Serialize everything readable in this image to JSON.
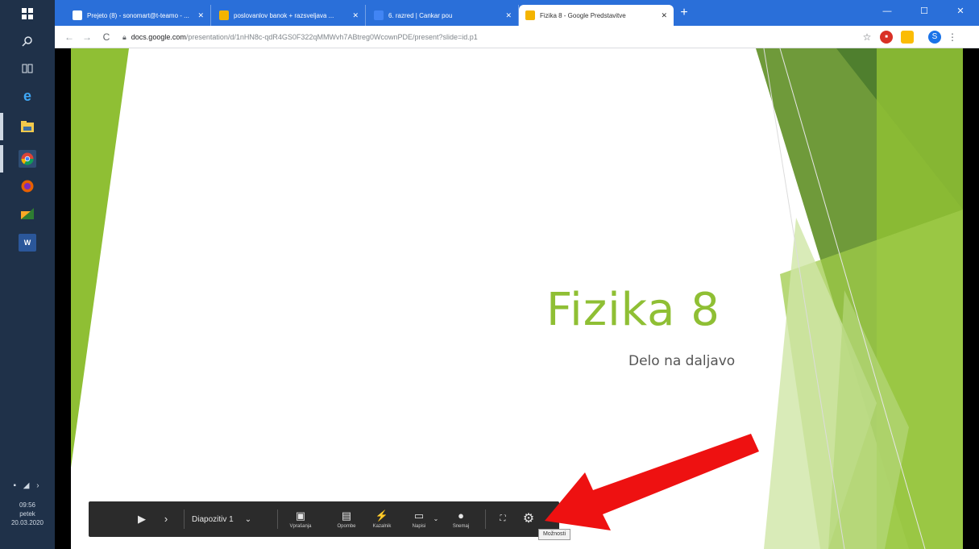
{
  "taskbar": {
    "clock_lines": [
      "09:56",
      "petek",
      "20.03.2020"
    ]
  },
  "browser": {
    "tabs": [
      {
        "title": "Prejeto (8) - sonomart@t-teamo - ...",
        "color": "#1a73e8"
      },
      {
        "title": "poslovanlov banok + razsveljava ...",
        "color": "#f4b400"
      },
      {
        "title": "6. razred | Cankar pou",
        "color": "#4285f4"
      },
      {
        "title": "Fizika 8 - Google Predstavitve",
        "color": "#f4b400",
        "active": true
      }
    ],
    "window_controls": {
      "minimize": "—",
      "maximize": "☐",
      "close": "✕"
    },
    "address": {
      "domain": "docs.google.com",
      "path": "/presentation/d/1nHN8c-qdR4GS0F322qMMWvh7ABtreg0WcownPDE/present?slide=id.p1"
    },
    "profile_initial": "S"
  },
  "slide": {
    "title": "Fizika 8",
    "subtitle": "Delo na daljavo"
  },
  "controls": {
    "slide_label": "Diapozitiv 1",
    "buttons": [
      {
        "label": "Vprašanja"
      },
      {
        "label": "Opombe"
      },
      {
        "label": "Kazalnik"
      },
      {
        "label": "Napisi"
      },
      {
        "label": "Snemaj"
      }
    ],
    "tooltip": "Možnosti"
  },
  "colors": {
    "accent_green": "#8fbf34",
    "arrow_red": "#ee1111"
  }
}
